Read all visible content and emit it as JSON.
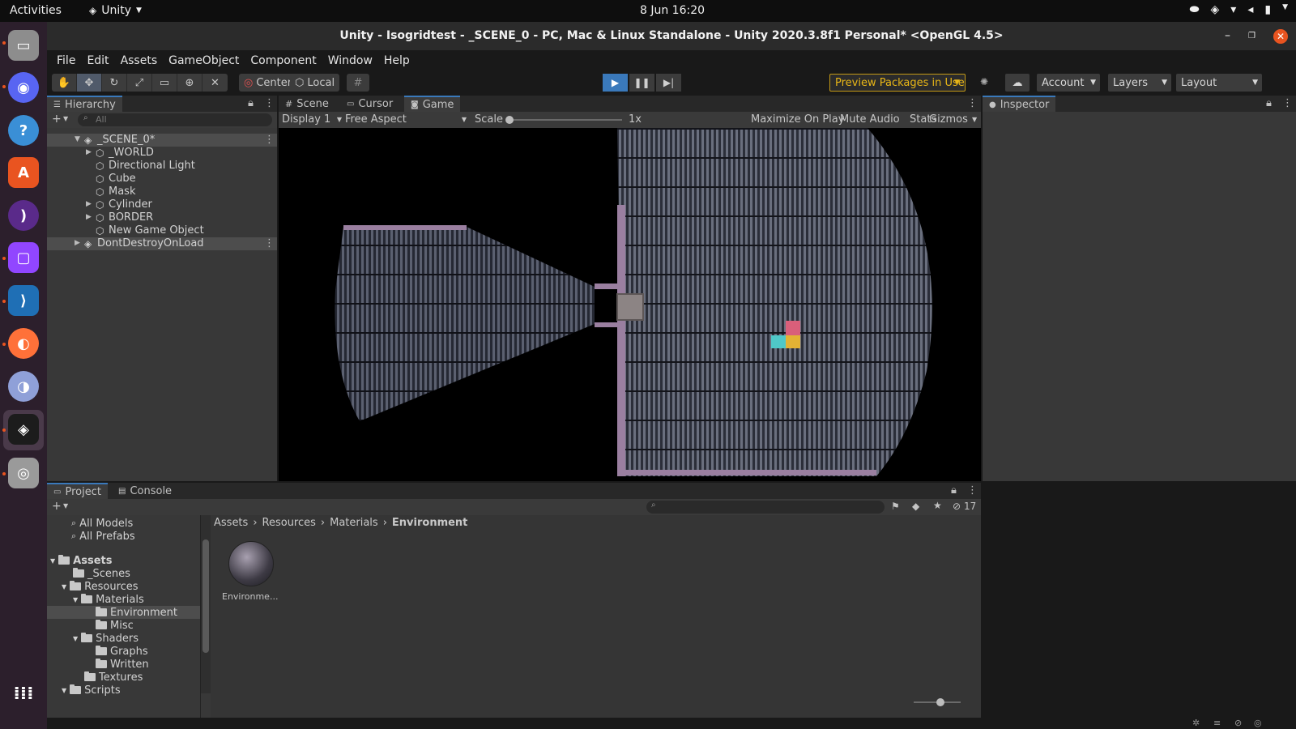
{
  "topbar": {
    "activities": "Activities",
    "app_name": "Unity",
    "clock": "8 Jun  16:20"
  },
  "window": {
    "title": "Unity - Isogridtest - _SCENE_0 - PC, Mac & Linux Standalone - Unity 2020.3.8f1 Personal* <OpenGL 4.5>"
  },
  "menu": [
    "File",
    "Edit",
    "Assets",
    "GameObject",
    "Component",
    "Window",
    "Help"
  ],
  "toolbar": {
    "pivot_center": "Center",
    "pivot_local": "Local",
    "preview_packages": "Preview Packages in Use",
    "account": "Account",
    "layers": "Layers",
    "layout": "Layout"
  },
  "hierarchy": {
    "tab": "Hierarchy",
    "search_placeholder": "All",
    "scene": "_SCENE_0*",
    "items": [
      "_WORLD",
      "Directional Light",
      "Cube",
      "Mask",
      "Cylinder",
      "BORDER",
      "New Game Object"
    ],
    "ddol": "DontDestroyOnLoad"
  },
  "center_tabs": {
    "scene": "Scene",
    "cursor": "Cursor",
    "game": "Game"
  },
  "game_controls": {
    "display": "Display 1",
    "aspect": "Free Aspect",
    "scale_label": "Scale",
    "scale_value": "1x",
    "maximize": "Maximize On Play",
    "mute": "Mute Audio",
    "stats": "Stats",
    "gizmos": "Gizmos"
  },
  "inspector": {
    "tab": "Inspector"
  },
  "project": {
    "tab_project": "Project",
    "tab_console": "Console",
    "hidden_count": "17",
    "favorites": [
      "All Models",
      "All Prefabs"
    ],
    "tree": {
      "assets": "Assets",
      "scenes": "_Scenes",
      "resources": "Resources",
      "materials": "Materials",
      "environment": "Environment",
      "misc": "Misc",
      "shaders": "Shaders",
      "graphs": "Graphs",
      "written": "Written",
      "textures": "Textures",
      "scripts": "Scripts"
    },
    "breadcrumb": [
      "Assets",
      "Resources",
      "Materials",
      "Environment"
    ],
    "asset_label": "Environme..."
  },
  "colors": {
    "accent": "#3a79bb",
    "warning": "#e8b617",
    "ubuntu_orange": "#e95420",
    "border_lilac": "#9a7fa0",
    "cube_pink": "#d95f7a",
    "cube_cyan": "#4fc8c8",
    "cube_yellow": "#e3b234"
  },
  "icons": {
    "dock": [
      "files-icon",
      "discord-icon",
      "help-icon",
      "software-center-icon",
      "podcast-icon",
      "twitch-icon",
      "vscode-icon",
      "firefox-icon",
      "krita-icon",
      "unity-icon",
      "disc-icon",
      "app-grid-icon"
    ]
  }
}
